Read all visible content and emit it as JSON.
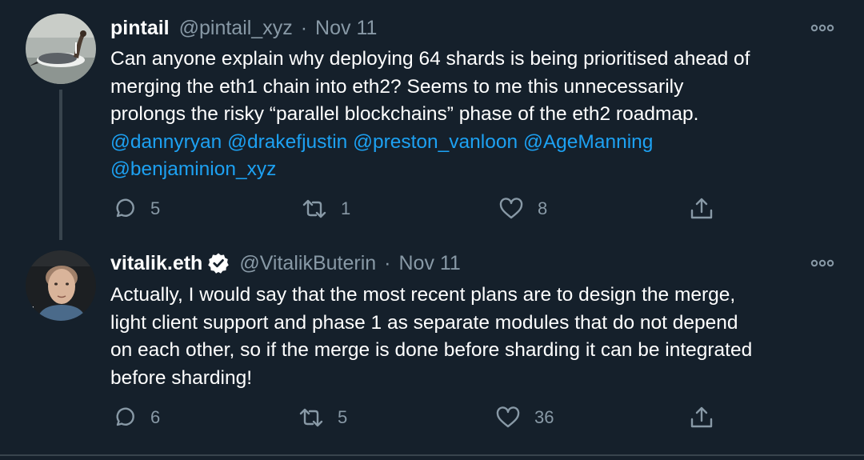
{
  "tweets": [
    {
      "display_name": "pintail",
      "handle": "@pintail_xyz",
      "separator": "·",
      "date": "Nov 11",
      "avatar_icon": "duck-avatar",
      "text_lines": [
        "Can anyone explain why deploying 64 shards is being prioritised ahead of",
        "merging the eth1 chain into eth2? Seems to me this unnecessarily",
        "prolongs the risky “parallel blockchains” phase of the eth2 roadmap."
      ],
      "mentions": [
        "@dannyryan",
        "@drakefjustin",
        "@preston_vanloon",
        "@AgeManning",
        "@benjaminion_xyz"
      ],
      "stats": {
        "replies": "5",
        "retweets": "1",
        "likes": "8"
      }
    },
    {
      "display_name": "vitalik.eth",
      "verified": true,
      "handle": "@VitalikButerin",
      "separator": "·",
      "date": "Nov 11",
      "avatar_icon": "person-avatar",
      "text_lines": [
        "Actually, I would say that the most recent plans are to design the merge,",
        "light client support and phase 1 as separate modules that do not depend",
        "on each other, so if the merge is done before sharding it can be integrated",
        "before sharding!"
      ],
      "stats": {
        "replies": "6",
        "retweets": "5",
        "likes": "36"
      }
    }
  ],
  "colors": {
    "background": "#15202b",
    "text": "#ffffff",
    "secondary": "#8899a6",
    "link": "#1da1f2",
    "divider": "#38444d"
  }
}
